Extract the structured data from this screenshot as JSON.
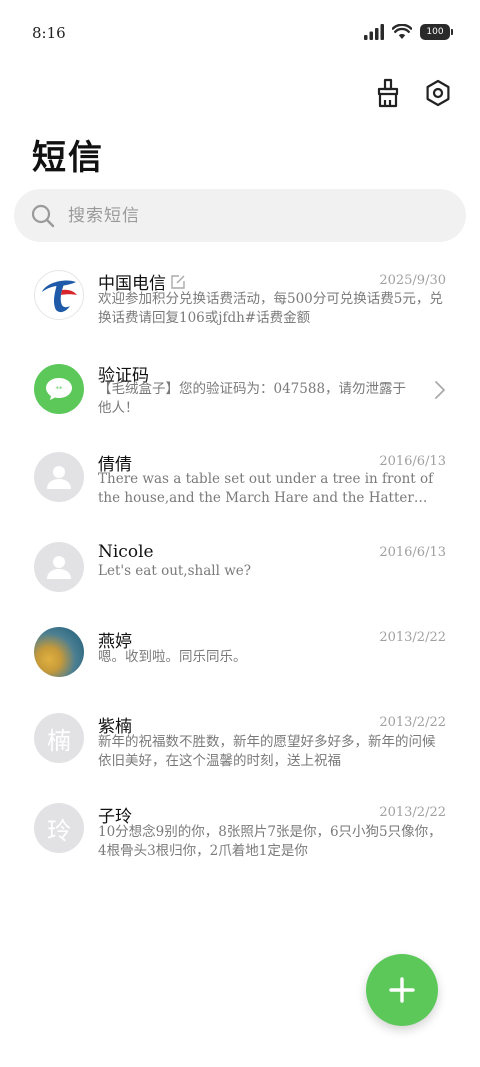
{
  "status_bar": {
    "time": "8:16",
    "battery": "100"
  },
  "header": {
    "title": "短信"
  },
  "search": {
    "placeholder": "搜索短信"
  },
  "messages": [
    {
      "name": "中国电信",
      "date": "2025/9/30",
      "preview": "欢迎参加积分兑换话费活动，每500分可兑换话费5元，兑换话费请回复106或jfdh#话费金额",
      "avatar": "china-telecom-logo-icon",
      "edited": true
    },
    {
      "name": "验证码",
      "date": "",
      "preview": "【毛绒盒子】您的验证码为：047588，请勿泄露于他人！",
      "avatar": "sms-bubble-icon",
      "chevron": true
    },
    {
      "name": "倩倩",
      "date": "2016/6/13",
      "preview": "There was a table set out under a tree in front of the house,and the March Hare and the Hatter were having tea at it",
      "avatar": "person-icon"
    },
    {
      "name": "Nicole",
      "date": "2016/6/13",
      "preview": "Let's eat out,shall we?",
      "avatar": "person-icon"
    },
    {
      "name": "燕婷",
      "date": "2013/2/22",
      "preview": "嗯。收到啦。同乐同乐。",
      "avatar": "photo-avatar"
    },
    {
      "name": "紫楠",
      "date": "2013/2/22",
      "preview": "新年的祝福数不胜数，新年的愿望好多好多，新年的问候依旧美好，在这个温馨的时刻，送上祝福",
      "avatar": "楠"
    },
    {
      "name": "子玲",
      "date": "2013/2/22",
      "preview": "10分想念9别的你，8张照片7张是你，6只小狗5只像你，4根骨头3根归你，2爪着地1定是你",
      "avatar": "玲"
    }
  ],
  "colors": {
    "accent": "#5cc85a",
    "telecom_blue": "#1f5aa8"
  }
}
